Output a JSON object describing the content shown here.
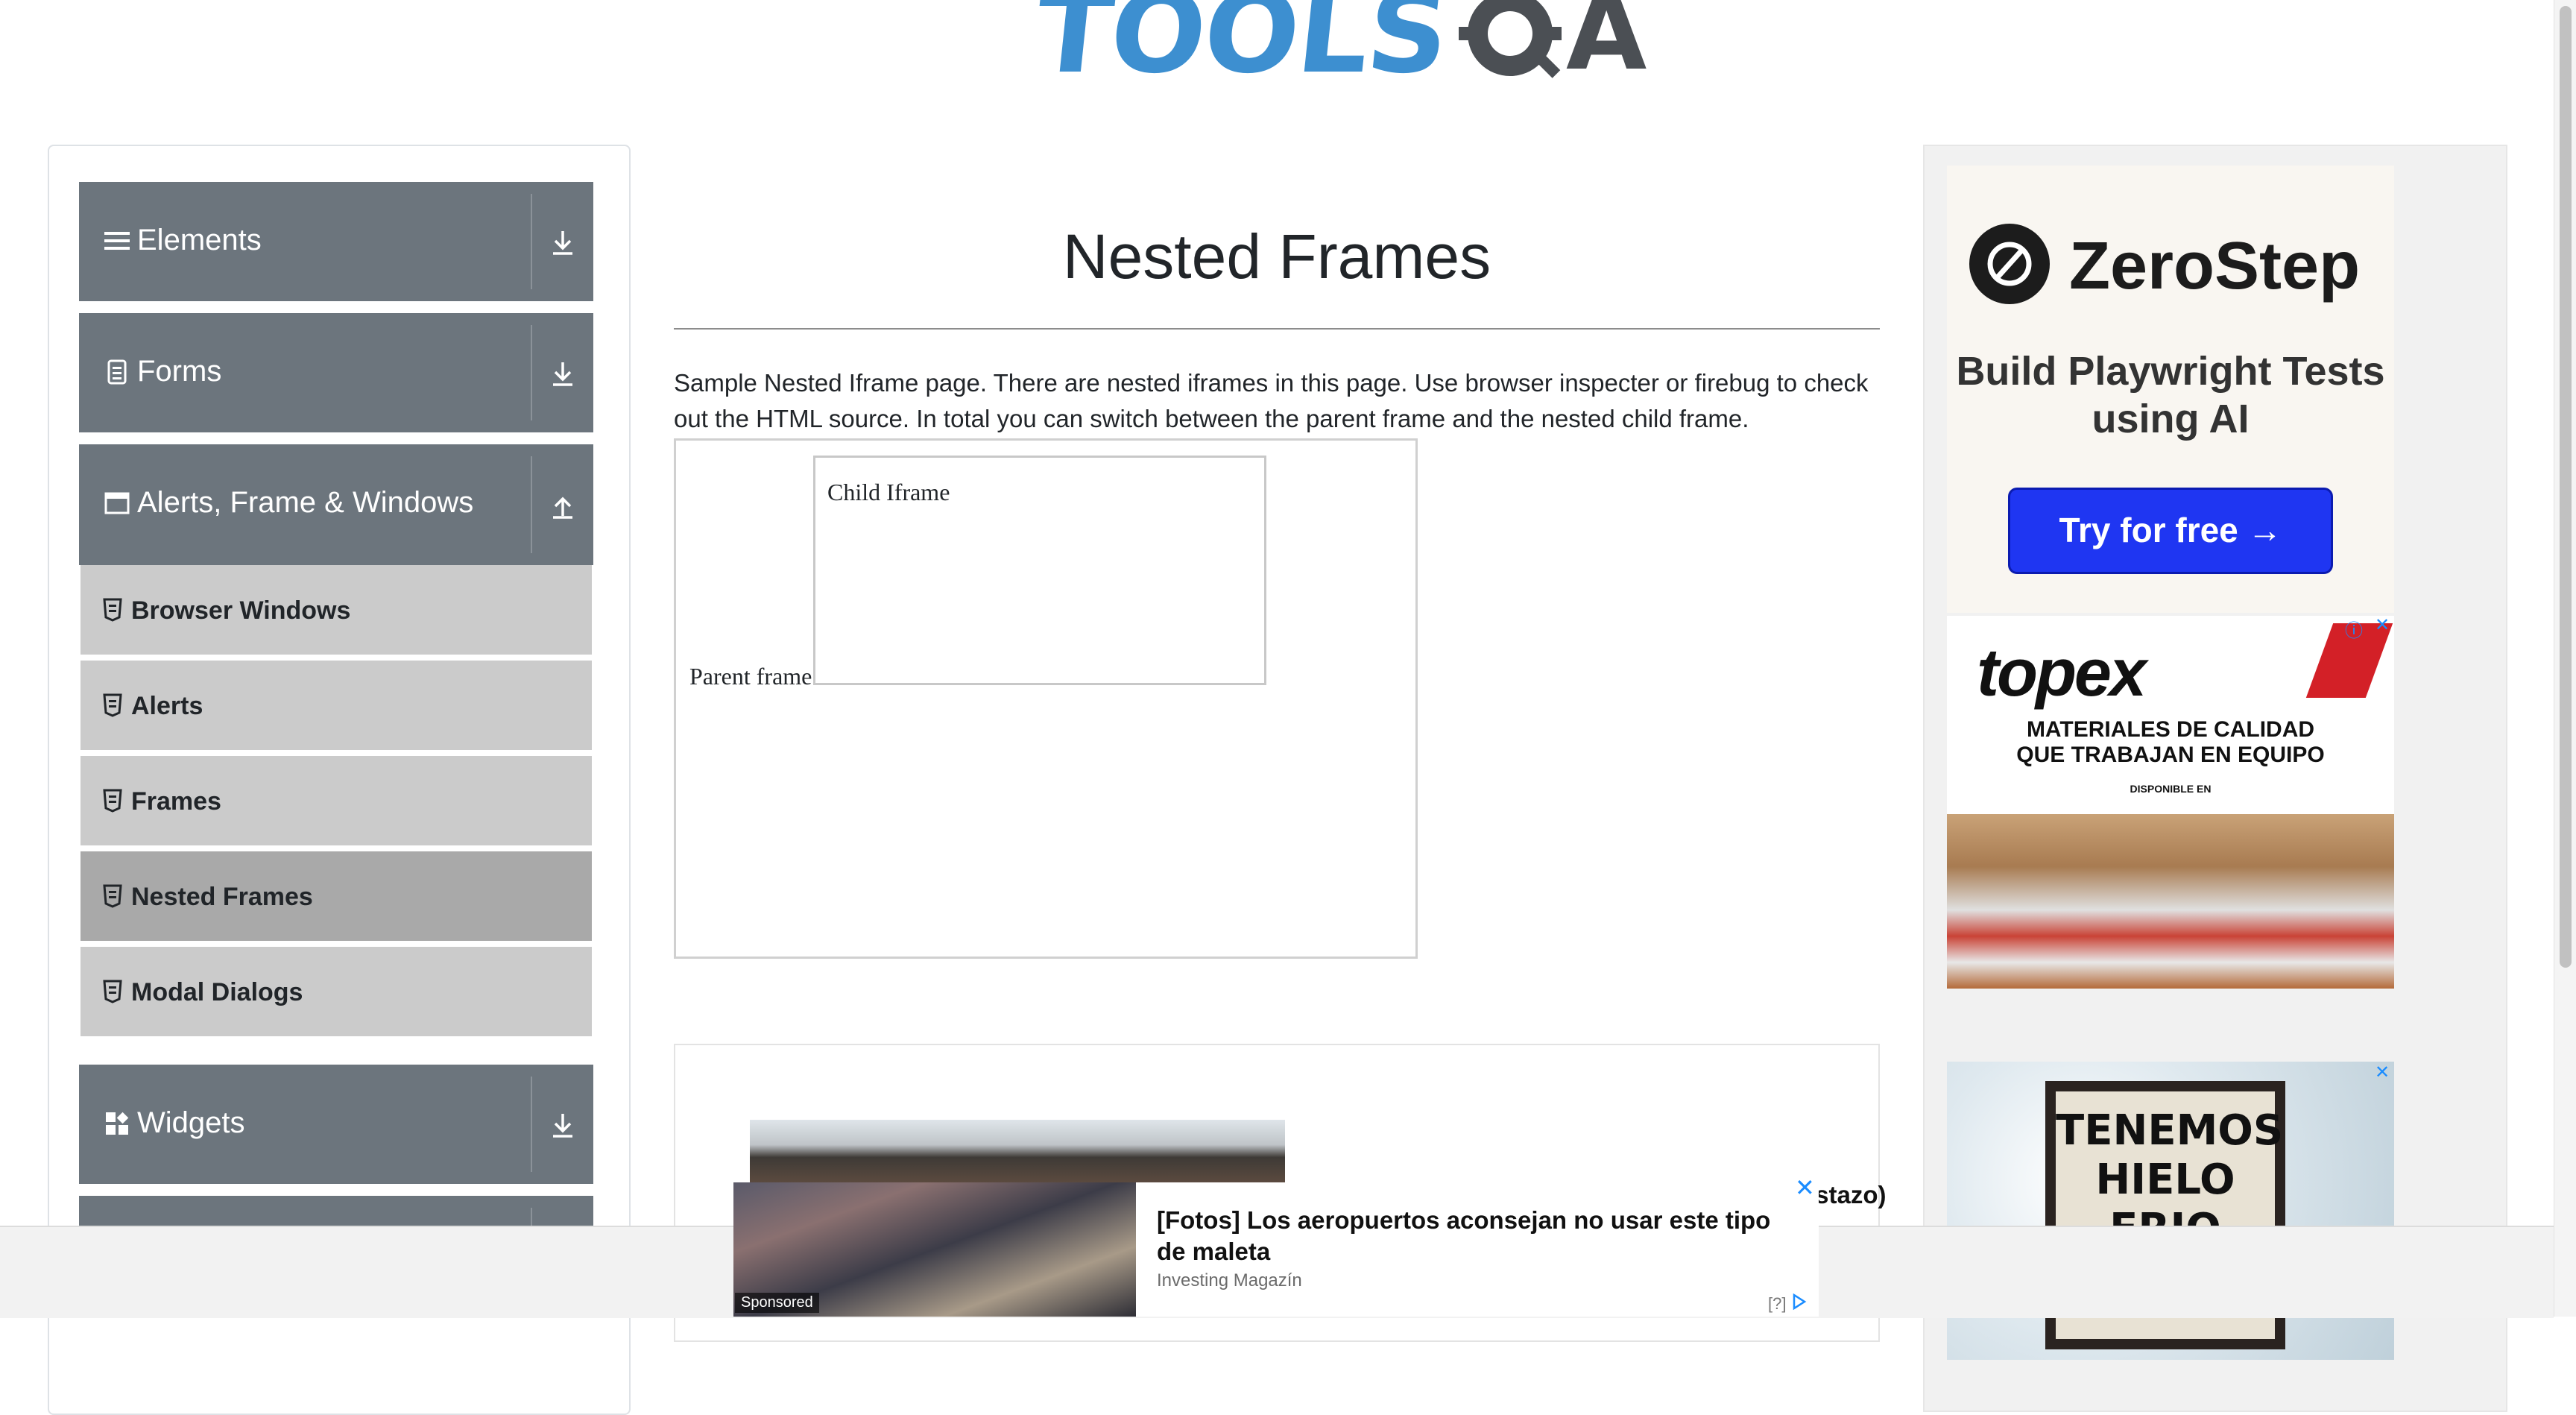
{
  "header": {
    "logo_text": "TOOLS",
    "logo_suffix": "A"
  },
  "sidebar": {
    "groups": [
      {
        "label": "Elements",
        "icon": "hamburger-icon",
        "expanded": false
      },
      {
        "label": "Forms",
        "icon": "document-icon",
        "expanded": false
      },
      {
        "label": "Alerts, Frame & Windows",
        "icon": "window-icon",
        "expanded": true
      },
      {
        "label": "Widgets",
        "icon": "grid-icon",
        "expanded": false
      }
    ],
    "items": [
      {
        "label": "Browser Windows",
        "active": false
      },
      {
        "label": "Alerts",
        "active": false
      },
      {
        "label": "Frames",
        "active": false
      },
      {
        "label": "Nested Frames",
        "active": true
      },
      {
        "label": "Modal Dialogs",
        "active": false
      }
    ]
  },
  "main": {
    "title": "Nested Frames",
    "description": "Sample Nested Iframe page. There are nested iframes in this page. Use browser inspecter or firebug to check out the HTML source. In total you can switch between the parent frame and the nested child frame.",
    "parent_frame_label": "Parent frame",
    "child_frame_label": "Child Iframe"
  },
  "ads": {
    "zerostep": {
      "brand": "ZeroStep",
      "tagline": "Build Playwright Tests using AI",
      "cta": "Try for free →"
    },
    "topex": {
      "brand": "topex",
      "line1": "MATERIALES DE CALIDAD",
      "line2": "QUE TRABAJAN EN EQUIPO",
      "small": "DISPONIBLE EN"
    },
    "ice": {
      "sign_text": "TENEMOS HIELO FRIO"
    },
    "bottom": {
      "headline": "[Fotos] Los aeropuertos aconsejan no usar este tipo de maleta",
      "source": "Investing Magazín",
      "sponsored": "Sponsored",
      "help": "[?]",
      "overlap_text": "istazo)"
    }
  },
  "colors": {
    "sidebar_group_bg": "#6c757d",
    "sidebar_item_bg": "#cbcbcb",
    "sidebar_item_active_bg": "#a9a9a9",
    "logo_blue": "#3d8fd0",
    "cta_blue": "#1f36f2"
  }
}
